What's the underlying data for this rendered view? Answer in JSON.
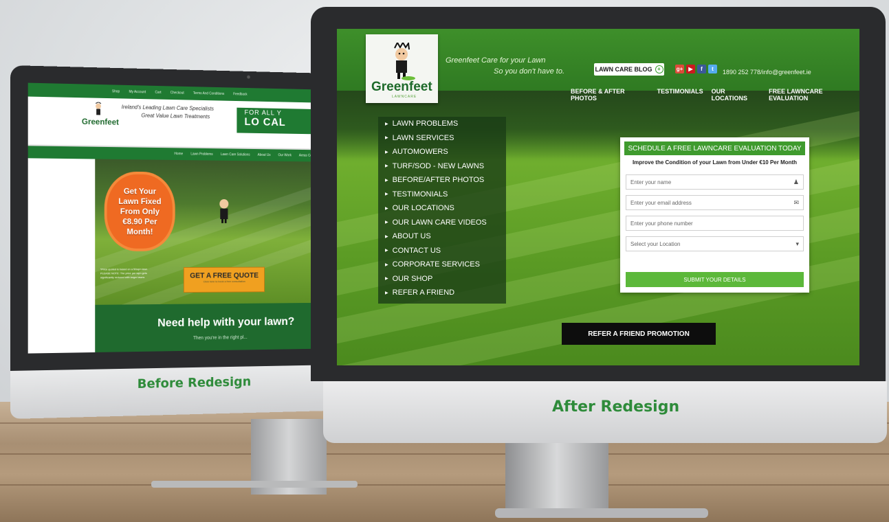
{
  "before": {
    "caption": "Before Redesign",
    "top_nav": [
      "Shop",
      "My Account",
      "Cart",
      "Checkout",
      "Terms And Conditions",
      "Feedback"
    ],
    "tagline_1": "Ireland's Leading Lawn Care Specialists",
    "tagline_2": "Great Value Lawn Treatments",
    "logo": "Greenfeet",
    "call_box_line1": "FOR ALL Y",
    "call_box_line2": "LO CAL",
    "main_nav": [
      "Home",
      "Lawn Problems",
      "Lawn Care Solutions",
      "About Us",
      "Our Work",
      "Areas Covered"
    ],
    "promo": [
      "Get Your",
      "Lawn Fixed",
      "From Only",
      "€8.90 Per",
      "Month!"
    ],
    "fine_print": [
      "*Price quoted is based on a 50sqm lawn",
      "PLEASE NOTE: The price per sqm gets",
      "significantly reduced with larger lawns"
    ],
    "quote_button": "GET A FREE QUOTE",
    "quote_sub": "Click here to book a free consultation",
    "help_title": "Need help with your lawn?",
    "help_sub": "Then you're in the right pl..."
  },
  "after": {
    "caption": "After Redesign",
    "logo": "Greenfeet",
    "logo_sub": "LAWNCARE",
    "tagline_1": "Greenfeet Care for your Lawn",
    "tagline_2": "So you don't have to.",
    "blog_button": "LAWN CARE BLOG",
    "social": [
      {
        "label": "g+",
        "color": "#dd4b39"
      },
      {
        "label": "▶",
        "color": "#cc181e"
      },
      {
        "label": "f",
        "color": "#3b5998"
      },
      {
        "label": "t",
        "color": "#55acee"
      }
    ],
    "contact": "1890 252 778/info@greenfeet.ie",
    "nav": [
      "BEFORE & AFTER PHOTOS",
      "TESTIMONIALS",
      "OUR LOCATIONS",
      "FREE LAWNCARE EVALUATION"
    ],
    "side_menu": [
      "LAWN PROBLEMS",
      "LAWN SERVICES",
      "AUTOMOWERS",
      "TURF/SOD - NEW LAWNS",
      "BEFORE/AFTER PHOTOS",
      "TESTIMONIALS",
      "OUR LOCATIONS",
      "OUR LAWN CARE VIDEOS",
      "ABOUT US",
      "CONTACT US",
      "CORPORATE SERVICES",
      "OUR SHOP",
      "REFER A FRIEND"
    ],
    "form": {
      "title": "SCHEDULE A FREE LAWNCARE EVALUATION TODAY",
      "subtitle": "Improve the Condition of your Lawn from Under €10 Per Month",
      "name_placeholder": "Enter your name",
      "email_placeholder": "Enter your email address",
      "phone_placeholder": "Enter your phone number",
      "location_placeholder": "Select your Location",
      "submit": "SUBMIT YOUR DETAILS"
    },
    "refer_button": "REFER A FRIEND PROMOTION"
  }
}
